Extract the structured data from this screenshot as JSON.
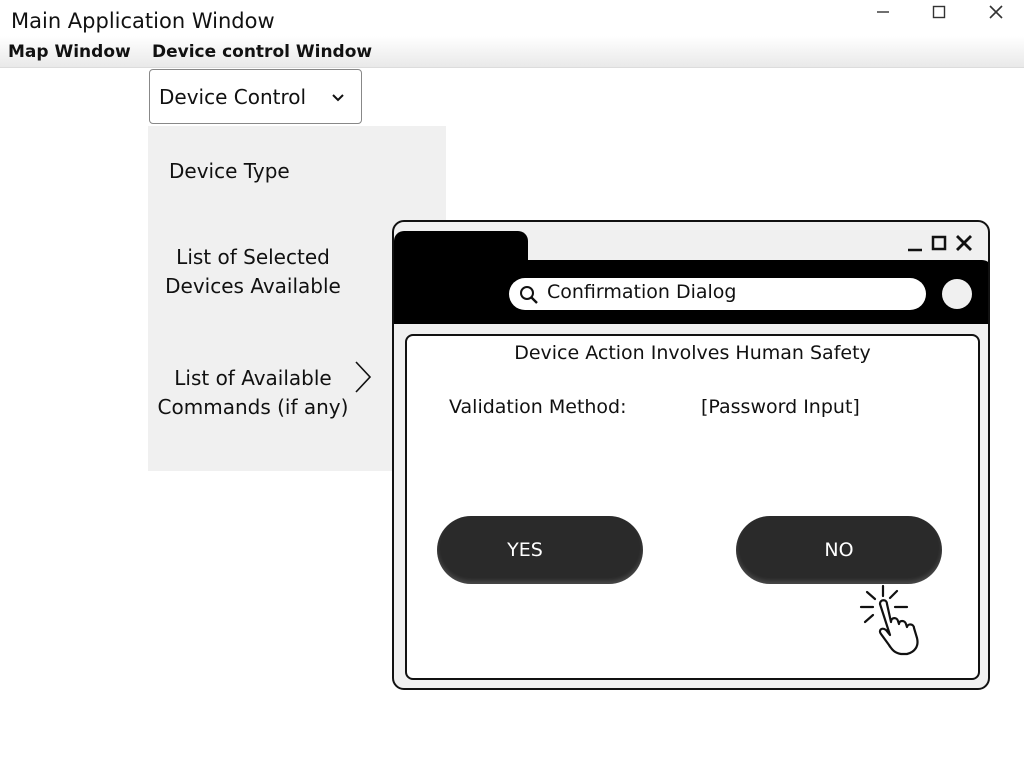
{
  "window": {
    "title": "Main Application Window",
    "controls": {
      "minimize_icon": "minimize-icon",
      "maximize_icon": "maximize-icon",
      "close_icon": "close-icon"
    }
  },
  "menubar": {
    "items": [
      "Map Window",
      "Device control Window"
    ]
  },
  "device_control": {
    "selected": "Device Control",
    "chevron_icon": "chevron-down-icon"
  },
  "panel": {
    "device_type": "Device Type",
    "selected_devices": [
      "List of Selected",
      "Devices Available"
    ],
    "commands": [
      "List of Available",
      "Commands (if any)"
    ],
    "commands_arrow_icon": "chevron-right-icon"
  },
  "dialog": {
    "search_text": "Confirmation Dialog",
    "search_icon": "search-icon",
    "heading": "Device Action Involves Human Safety",
    "validation_label": "Validation Method:",
    "validation_value": "[Password Input]",
    "yes_label": "YES",
    "no_label": "NO",
    "cursor_icon": "hand-click-icon"
  },
  "colors": {
    "panel_bg": "#f0f0f0",
    "dialog_header": "#000000",
    "button_bg": "#2a2a2a"
  }
}
